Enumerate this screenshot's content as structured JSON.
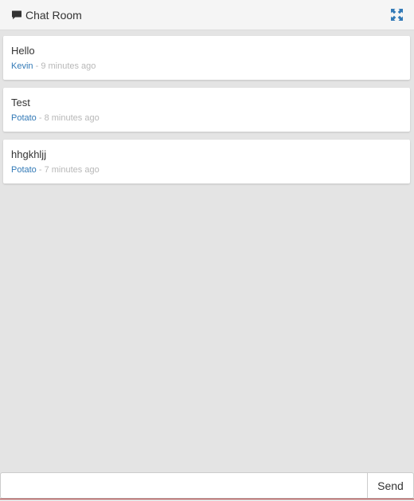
{
  "header": {
    "title": "Chat Room",
    "icon": "chat-bubble-icon",
    "expand_icon": "expand-icon"
  },
  "messages": [
    {
      "text": "Hello",
      "author": "Kevin",
      "separator": " - ",
      "time": "9 minutes ago"
    },
    {
      "text": "Test",
      "author": "Potato",
      "separator": " - ",
      "time": "8 minutes ago"
    },
    {
      "text": "hhgkhljj",
      "author": "Potato",
      "separator": " - ",
      "time": "7 minutes ago"
    }
  ],
  "composer": {
    "value": "",
    "send_label": "Send"
  },
  "colors": {
    "background": "#e4e4e4",
    "header_bg": "#f5f5f5",
    "author_link": "#337ab7",
    "meta_gray": "#b8b8b8",
    "accent_line": "#b03a3a"
  }
}
